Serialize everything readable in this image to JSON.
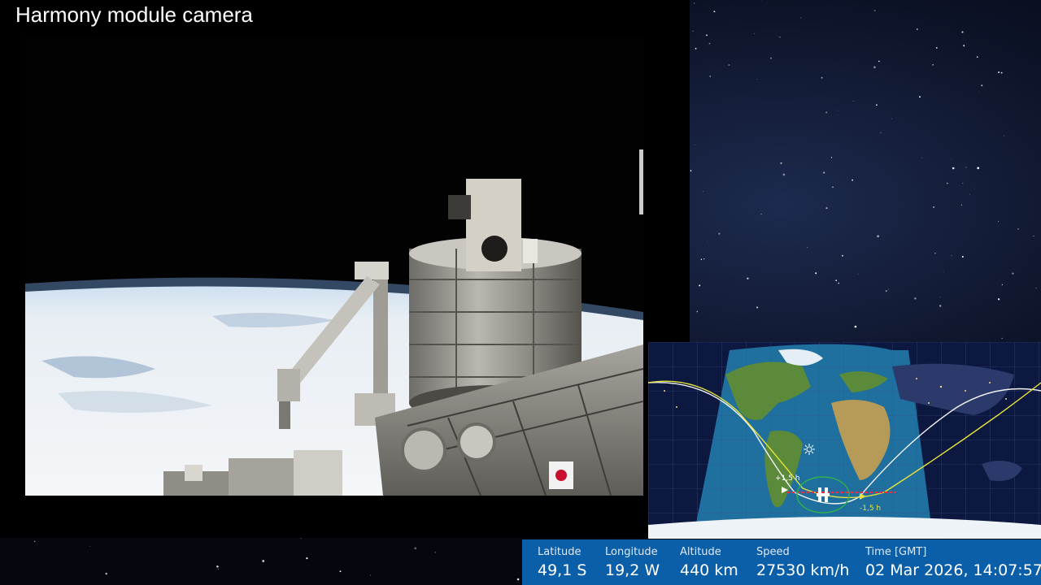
{
  "camera": {
    "title": "Harmony module camera",
    "japan_flag_color": "#c8102e"
  },
  "map": {
    "past_marker": "+1,5 h",
    "future_marker": "-1,5 h",
    "sun_icon": "sun-icon",
    "iss_icon": "iss-icon",
    "track_colors": {
      "past": "#ffffff",
      "future": "#e6e23a",
      "ground": "#e0304a"
    }
  },
  "telemetry": {
    "latitude": {
      "label": "Latitude",
      "value": "49,1 S"
    },
    "longitude": {
      "label": "Longitude",
      "value": "19,2 W"
    },
    "altitude": {
      "label": "Altitude",
      "value": "440 km"
    },
    "speed": {
      "label": "Speed",
      "value": "27530 km/h"
    },
    "time": {
      "label": "Time [GMT]",
      "value": "02 Mar 2026, 14:07:57"
    },
    "bar_color": "#0b5fa8"
  }
}
